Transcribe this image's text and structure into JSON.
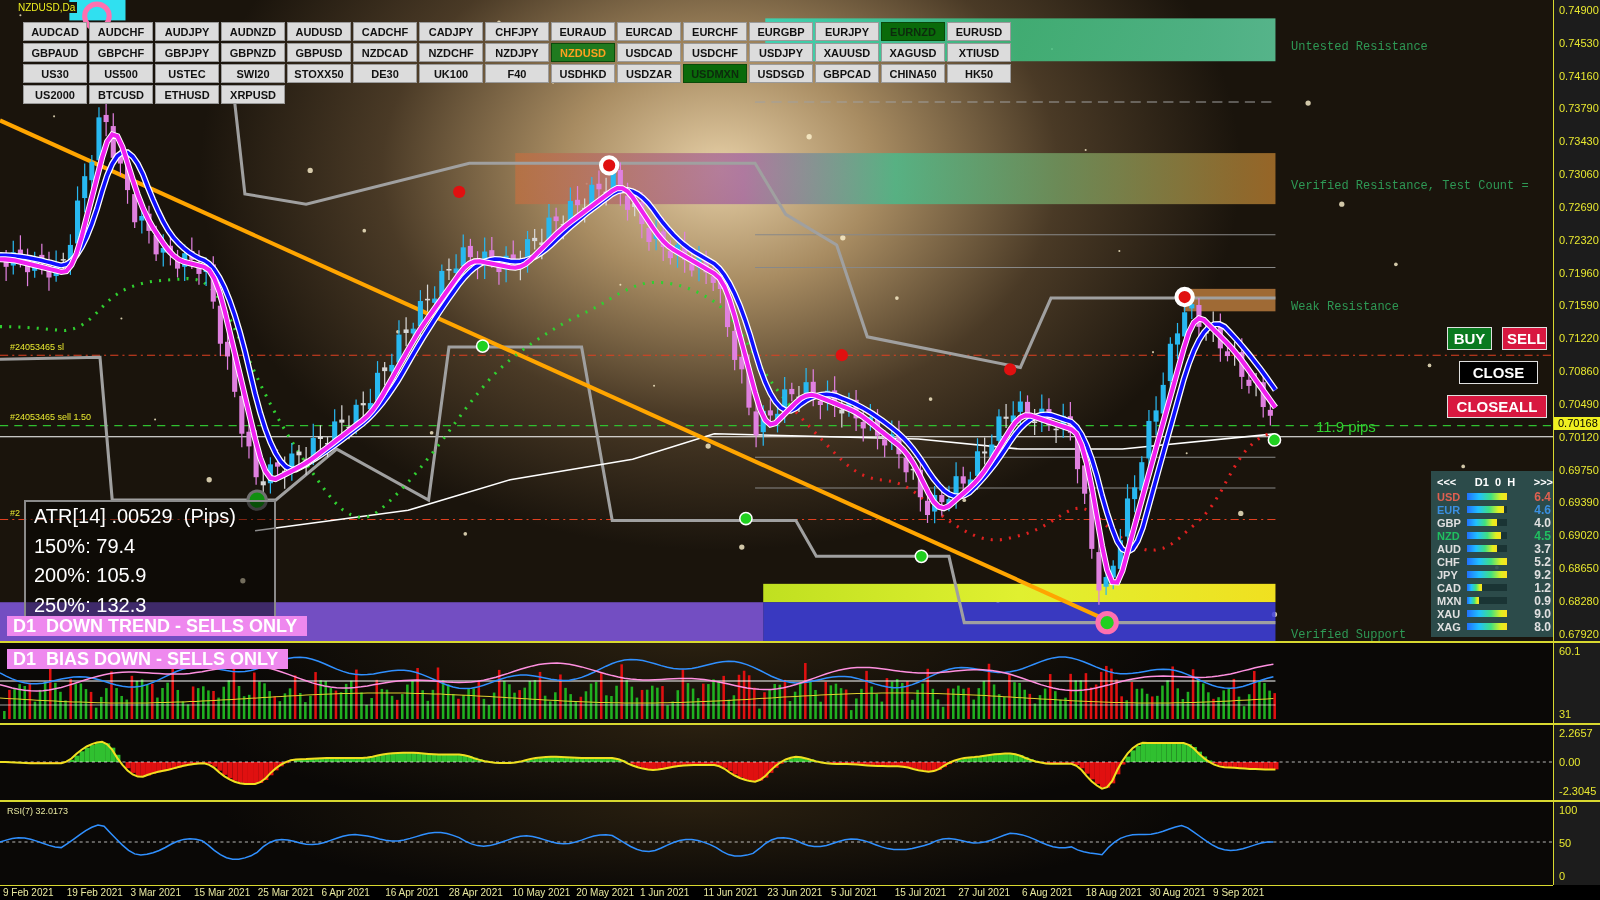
{
  "chart_title": "NZDUSD,Da",
  "symbol_buttons": [
    {
      "label": "AUDCAD",
      "selected": false,
      "related": false
    },
    {
      "label": "AUDCHF",
      "selected": false,
      "related": false
    },
    {
      "label": "AUDJPY",
      "selected": false,
      "related": false
    },
    {
      "label": "AUDNZD",
      "selected": false,
      "related": false
    },
    {
      "label": "AUDUSD",
      "selected": false,
      "related": false
    },
    {
      "label": "CADCHF",
      "selected": false,
      "related": false
    },
    {
      "label": "CADJPY",
      "selected": false,
      "related": false
    },
    {
      "label": "CHFJPY",
      "selected": false,
      "related": false
    },
    {
      "label": "EURAUD",
      "selected": false,
      "related": false
    },
    {
      "label": "EURCAD",
      "selected": false,
      "related": false
    },
    {
      "label": "EURCHF",
      "selected": false,
      "related": false
    },
    {
      "label": "EURGBP",
      "selected": false,
      "related": false
    },
    {
      "label": "EURJPY",
      "selected": false,
      "related": false
    },
    {
      "label": "EURNZD",
      "selected": false,
      "related": true
    },
    {
      "label": "EURUSD",
      "selected": false,
      "related": false
    },
    {
      "label": "GBPAUD",
      "selected": false,
      "related": false
    },
    {
      "label": "GBPCHF",
      "selected": false,
      "related": false
    },
    {
      "label": "GBPJPY",
      "selected": false,
      "related": false
    },
    {
      "label": "GBPNZD",
      "selected": false,
      "related": false
    },
    {
      "label": "GBPUSD",
      "selected": false,
      "related": false
    },
    {
      "label": "NZDCAD",
      "selected": false,
      "related": false
    },
    {
      "label": "NZDCHF",
      "selected": false,
      "related": false
    },
    {
      "label": "NZDJPY",
      "selected": false,
      "related": false
    },
    {
      "label": "NZDUSD",
      "selected": true,
      "related": false
    },
    {
      "label": "USDCAD",
      "selected": false,
      "related": false
    },
    {
      "label": "USDCHF",
      "selected": false,
      "related": false
    },
    {
      "label": "USDJPY",
      "selected": false,
      "related": false
    },
    {
      "label": "XAUUSD",
      "selected": false,
      "related": false
    },
    {
      "label": "XAGUSD",
      "selected": false,
      "related": false
    },
    {
      "label": "XTIUSD",
      "selected": false,
      "related": false
    },
    {
      "label": "US30",
      "selected": false,
      "related": false
    },
    {
      "label": "US500",
      "selected": false,
      "related": false
    },
    {
      "label": "USTEC",
      "selected": false,
      "related": false
    },
    {
      "label": "SWI20",
      "selected": false,
      "related": false
    },
    {
      "label": "STOXX50",
      "selected": false,
      "related": false
    },
    {
      "label": "DE30",
      "selected": false,
      "related": false
    },
    {
      "label": "UK100",
      "selected": false,
      "related": false
    },
    {
      "label": "F40",
      "selected": false,
      "related": false
    },
    {
      "label": "USDHKD",
      "selected": false,
      "related": false
    },
    {
      "label": "USDZAR",
      "selected": false,
      "related": false
    },
    {
      "label": "USDMXN",
      "selected": false,
      "related": true
    },
    {
      "label": "USDSGD",
      "selected": false,
      "related": false
    },
    {
      "label": "GBPCAD",
      "selected": false,
      "related": false
    },
    {
      "label": "CHINA50",
      "selected": false,
      "related": false
    },
    {
      "label": "HK50",
      "selected": false,
      "related": false
    },
    {
      "label": "US2000",
      "selected": false,
      "related": false
    },
    {
      "label": "BTCUSD",
      "selected": false,
      "related": false
    },
    {
      "label": "ETHUSD",
      "selected": false,
      "related": false
    },
    {
      "label": "XRPUSD",
      "selected": false,
      "related": false
    }
  ],
  "zone_labels": [
    "Untested Resistance",
    "Verified Resistance, Test Count =",
    "Weak Resistance",
    "Verified Support"
  ],
  "trade_line_labels": [
    "#24053465 sl",
    "#24053465 sell 1.50",
    "#2"
  ],
  "pips_label": "11.9 pips",
  "atr_box": {
    "lines": [
      "ATR[14] .00529  (Pips)",
      "150%: 79.4",
      "200%: 105.9",
      "250%: 132.3"
    ]
  },
  "trend_banner": "D1  DOWN TREND - SELLS ONLY",
  "bias_banner": "D1  BIAS DOWN - SELLS ONLY",
  "trade_buttons": [
    {
      "label": "BUY",
      "kind": "buy"
    },
    {
      "label": "SELL",
      "kind": "sell"
    },
    {
      "label": "CLOSE",
      "kind": "close"
    },
    {
      "label": "CLOSEALL",
      "kind": "closeall"
    }
  ],
  "strength_panel": {
    "prev": "<<<",
    "title": "D1  0  H",
    "next": ">>>",
    "rows": [
      {
        "currency": "USD",
        "value": "6.4",
        "level": 1.0,
        "color": "#e06050"
      },
      {
        "currency": "EUR",
        "value": "4.6",
        "level": 0.92,
        "color": "#3a8fe0"
      },
      {
        "currency": "GBP",
        "value": "4.0",
        "level": 0.76,
        "color": "#e0e0e0"
      },
      {
        "currency": "NZD",
        "value": "4.5",
        "level": 0.84,
        "color": "#20c060"
      },
      {
        "currency": "AUD",
        "value": "3.7",
        "level": 0.76,
        "color": "#e0e0e0"
      },
      {
        "currency": "CHF",
        "value": "5.2",
        "level": 1.0,
        "color": "#e0e0e0"
      },
      {
        "currency": "JPY",
        "value": "9.2",
        "level": 1.0,
        "color": "#e0e0e0"
      },
      {
        "currency": "CAD",
        "value": "1.2",
        "level": 0.37,
        "color": "#e0e0e0"
      },
      {
        "currency": "MXN",
        "value": "0.9",
        "level": 0.29,
        "color": "#e0e0e0"
      },
      {
        "currency": "XAU",
        "value": "9.0",
        "level": 1.0,
        "color": "#e0e0e0"
      },
      {
        "currency": "XAG",
        "value": "8.0",
        "level": 1.0,
        "color": "#e0e0e0"
      }
    ]
  },
  "price_axis": {
    "labels": [
      "0.74900",
      "0.74530",
      "0.74160",
      "0.73790",
      "0.73430",
      "0.73060",
      "0.72690",
      "0.72320",
      "0.71960",
      "0.71590",
      "0.71220",
      "0.70860",
      "0.70490",
      "0.70120",
      "0.69750",
      "0.69390",
      "0.69020",
      "0.68650",
      "0.68280",
      "0.67920"
    ],
    "current_price": "0.70168"
  },
  "oscillator_1": {
    "axis_labels": [
      "60.1",
      "31"
    ]
  },
  "oscillator_2": {
    "axis_labels": [
      "2.2657",
      "0.00",
      "-2.3045"
    ]
  },
  "rsi": {
    "label": "RSI(7) 32.0173",
    "axis_labels": [
      "100",
      "50",
      "0"
    ]
  },
  "time_axis": {
    "labels": [
      "9 Feb 2021",
      "19 Feb 2021",
      "3 Mar 2021",
      "15 Mar 2021",
      "25 Mar 2021",
      "6 Apr 2021",
      "16 Apr 2021",
      "28 Apr 2021",
      "10 May 2021",
      "20 May 2021",
      "1 Jun 2021",
      "11 Jun 2021",
      "23 Jun 2021",
      "5 Jul 2021",
      "15 Jul 2021",
      "27 Jul 2021",
      "6 Aug 2021",
      "18 Aug 2021",
      "30 Aug 2021",
      "9 Sep 2021"
    ]
  }
}
